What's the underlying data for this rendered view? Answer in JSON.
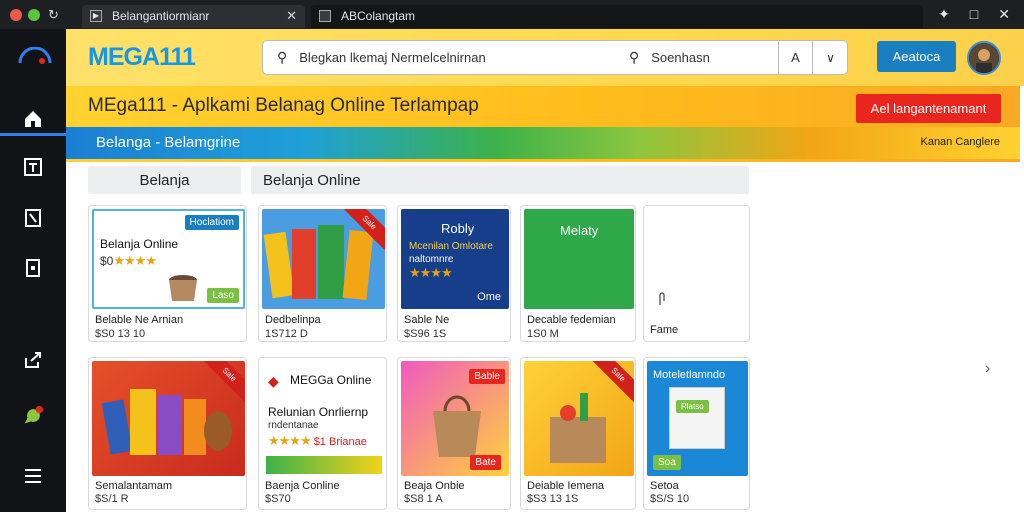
{
  "window": {
    "tabs": [
      {
        "label": "Belangantiormianr",
        "active": true
      },
      {
        "label": "ABColangtam",
        "active": false
      }
    ]
  },
  "sidebar": {
    "items": [
      "home-icon",
      "tablet-icon",
      "bookmark-icon",
      "page-icon",
      "share-icon",
      "chat-icon",
      "menu-icon"
    ]
  },
  "header": {
    "brand": "MEGA111",
    "search_placeholder": "Blegkan lkemaj Nermelcelnirnan",
    "search_query": "Soenhasn",
    "search_button_glyph": "A",
    "action_button": "Aeatoca"
  },
  "banner": {
    "title": "MEga111 - Aplkami Belanag Online Terlampap",
    "cta": "Ael langantenamant",
    "stripe_text": "Belanga - Belamgrine",
    "stripe_right": "Kanan Canglere"
  },
  "chips": {
    "left": "Belanja",
    "right": "Belanja Online"
  },
  "products_row1": [
    {
      "name": "Belable Ne Arnian",
      "price": "$S0 13 10",
      "img_title": "Belanja Online",
      "img_price": "$0",
      "tag": "Hoclatiom",
      "badge": "Laso"
    },
    {
      "name": "Dedbelinpa",
      "price": "1S712 D",
      "ribbon": "Sale"
    },
    {
      "name": "Sable Ne",
      "price": "$S96 1S",
      "img_title": "Robly",
      "img_sub": "Mcenilan Omlotare",
      "img_sub2": "naltomnre",
      "img_foot": "Ome"
    },
    {
      "name": "Decable fedemian",
      "price": "1S0 M",
      "img_title": "Melaty"
    },
    {
      "name": "Fame",
      "price": ""
    }
  ],
  "products_row2": [
    {
      "name": "Semalantamam",
      "price": "$S/1 R",
      "ribbon": "Sale"
    },
    {
      "name": "Baenja Conline",
      "price": "$S70",
      "img_title": "MEGGa Online",
      "img_sub": "Relunian Onrliernp",
      "img_sub2": "rndentanae",
      "img_price": "$1 Brianae"
    },
    {
      "name": "Beaja Onbie",
      "price": "$S8 1 A",
      "badge_top": "Bable",
      "badge_bottom": "Bate"
    },
    {
      "name": "Deiable  Iemena",
      "price": "$S3 13 1S",
      "ribbon": "Sale"
    },
    {
      "name": "Setoa",
      "price": "$S/S 10",
      "img_title": "Moteletlamndo",
      "badge_mid": "Rlatso",
      "badge_bottom": "Soa"
    }
  ],
  "colors": {
    "brand_blue": "#1597e5",
    "banner_yellow": "#ffd230",
    "cta_red": "#e8261e"
  }
}
